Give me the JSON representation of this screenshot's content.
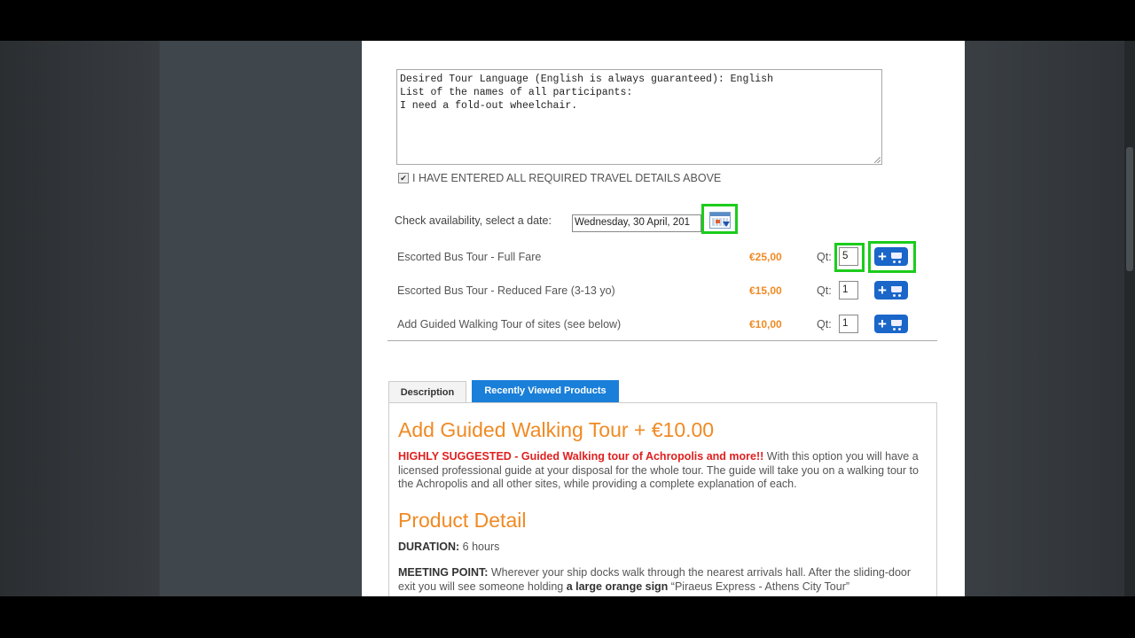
{
  "notes": {
    "lines": [
      "Desired Tour Language (English is always guaranteed): English",
      "List of the names of all participants:",
      "I need a fold-out wheelchair."
    ]
  },
  "confirm": {
    "checked": true,
    "label": "I HAVE ENTERED ALL REQUIRED TRAVEL DETAILS ABOVE"
  },
  "availability": {
    "label": "Check availability, select a date:",
    "date_value": "Wednesday, 30 April, 201"
  },
  "products": [
    {
      "name": "Escorted Bus Tour - Full Fare",
      "price": "€25,00",
      "qty_label": "Qt:",
      "qty": "5",
      "highlighted": true
    },
    {
      "name": "Escorted Bus Tour - Reduced Fare (3-13 yo)",
      "price": "€15,00",
      "qty_label": "Qt:",
      "qty": "1",
      "highlighted": false
    },
    {
      "name": "Add Guided Walking Tour of sites (see below)",
      "price": "€10,00",
      "qty_label": "Qt:",
      "qty": "1",
      "highlighted": false
    }
  ],
  "tabs": {
    "description": "Description",
    "recent": "Recently Viewed Products"
  },
  "content": {
    "heading1": "Add Guided Walking Tour + €10.00",
    "suggested": "HIGHLY SUGGESTED - Guided Walking tour of Achropolis and more!!",
    "para1": " With this option you will have a licensed professional guide at your disposal for the whole tour. The guide will take you on a walking tour to the Achropolis and all other sites, while providing a complete explanation of each.",
    "heading2": "Product Detail",
    "duration_label": "DURATION:",
    "duration_value": " 6 hours",
    "meeting_label": "MEETING POINT:",
    "meeting_text": " Wherever your ship docks walk through the nearest arrivals hall. After the sliding-door exit you will see someone holding ",
    "meeting_sign": "a large orange sign",
    "meeting_quote": " “Piraeus Express - Athens City Tour”"
  },
  "colors": {
    "accent_orange": "#f08a24",
    "tab_blue": "#1a7fd8",
    "highlight_green": "#1ccc1c",
    "suggest_red": "#e02020"
  }
}
